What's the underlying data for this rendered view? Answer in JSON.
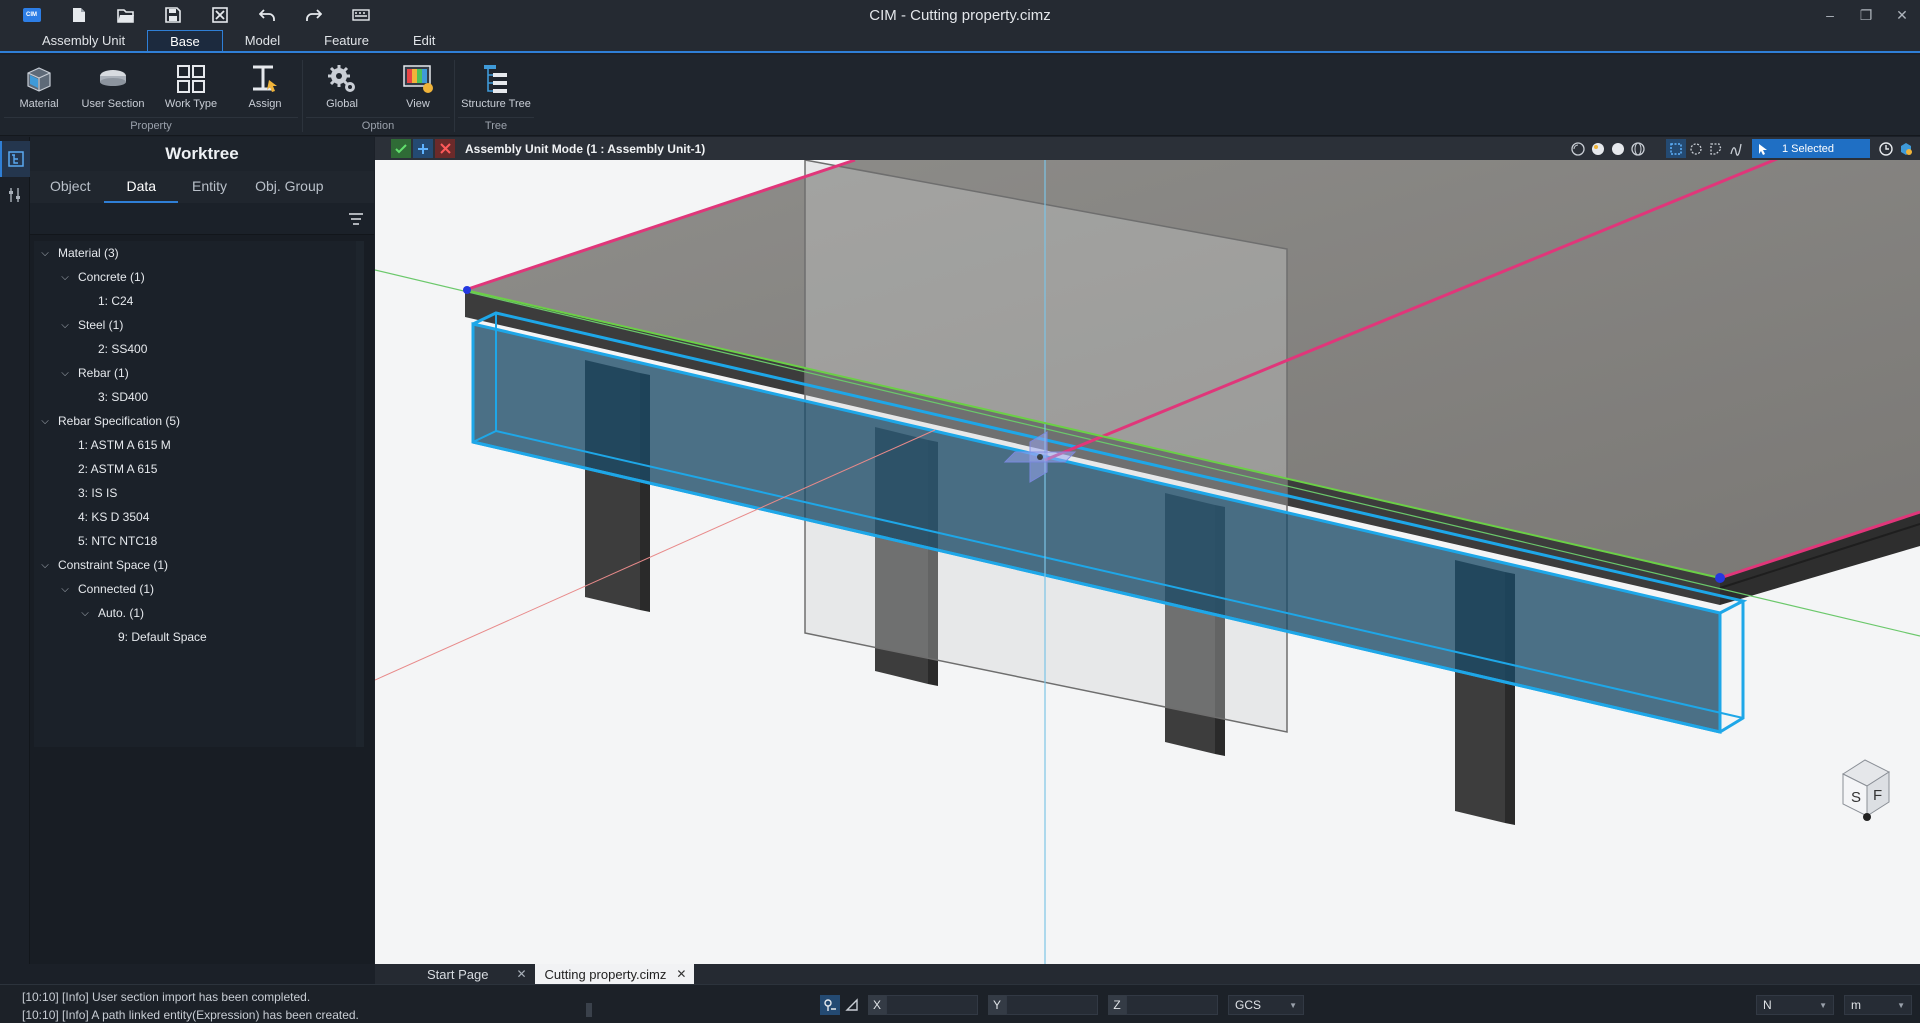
{
  "window": {
    "title": "CIM - Cutting property.cimz",
    "logo_text": "CIM",
    "minimize": "–",
    "restore": "❐",
    "close": "✕"
  },
  "menu": {
    "tabs": [
      "Assembly Unit",
      "Base",
      "Model",
      "Feature",
      "Edit"
    ],
    "active": "Base"
  },
  "ribbon": {
    "buttons": [
      "Material",
      "User Section",
      "Work Type",
      "Assign",
      "Global",
      "View",
      "Structure Tree"
    ],
    "groups": [
      "Property",
      "Option",
      "Tree"
    ]
  },
  "worktree": {
    "title": "Worktree",
    "tabs": [
      "Object",
      "Data",
      "Entity",
      "Obj. Group"
    ],
    "active_tab": "Data",
    "items": [
      {
        "label": "Material (3)",
        "expanded": true
      },
      {
        "label": "Concrete (1)",
        "expanded": true
      },
      {
        "label": "1: C24"
      },
      {
        "label": "Steel (1)",
        "expanded": true
      },
      {
        "label": "2: SS400"
      },
      {
        "label": "Rebar (1)",
        "expanded": true
      },
      {
        "label": "3: SD400"
      },
      {
        "label": "Rebar Specification (5)",
        "expanded": true
      },
      {
        "label": "1: ASTM A 615 M"
      },
      {
        "label": "2: ASTM A 615"
      },
      {
        "label": "3: IS IS"
      },
      {
        "label": "4: KS D 3504"
      },
      {
        "label": "5: NTC NTC18"
      },
      {
        "label": "Constraint Space (1)",
        "expanded": true
      },
      {
        "label": "Connected (1)",
        "expanded": true
      },
      {
        "label": "Auto. (1)",
        "expanded": true
      },
      {
        "label": "9: Default Space"
      }
    ]
  },
  "viewport": {
    "mode_text": "Assembly Unit Mode (1 : Assembly Unit-1)",
    "selection_text": "1 Selected",
    "cube_labels": [
      "S",
      "F"
    ]
  },
  "documents": {
    "tabs": [
      "Start Page",
      "Cutting property.cimz"
    ],
    "active": "Cutting property.cimz"
  },
  "log": {
    "lines": [
      "[10:10] [Info] User section import has been completed.",
      "[10:10] [Info] A path linked entity(Expression) has been created."
    ]
  },
  "status": {
    "x_label": "X",
    "y_label": "Y",
    "z_label": "Z",
    "coord_system": "GCS",
    "force_unit": "N",
    "length_unit": "m"
  },
  "colors": {
    "accent": "#2f7fd6",
    "selection": "#1ea7e8",
    "edge_highlight": "#e0367a"
  }
}
